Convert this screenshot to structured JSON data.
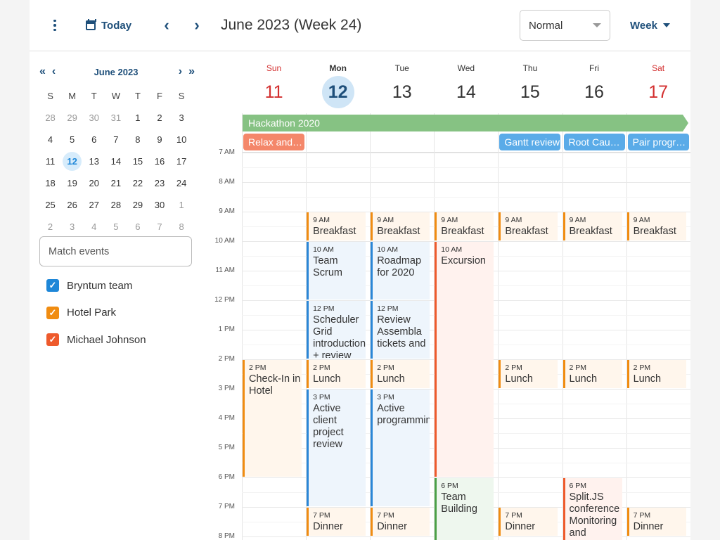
{
  "toolbar": {
    "today_label": "Today",
    "title": "June 2023 (Week 24)",
    "mode_value": "Normal",
    "view_label": "Week"
  },
  "mini_calendar": {
    "title": "June 2023",
    "weekdays": [
      "S",
      "M",
      "T",
      "W",
      "T",
      "F",
      "S"
    ],
    "weeks": [
      [
        "28",
        "29",
        "30",
        "31",
        "1",
        "2",
        "3"
      ],
      [
        "4",
        "5",
        "6",
        "7",
        "8",
        "9",
        "10"
      ],
      [
        "11",
        "12",
        "13",
        "14",
        "15",
        "16",
        "17"
      ],
      [
        "18",
        "19",
        "20",
        "21",
        "22",
        "23",
        "24"
      ],
      [
        "25",
        "26",
        "27",
        "28",
        "29",
        "30",
        "1"
      ],
      [
        "2",
        "3",
        "4",
        "5",
        "6",
        "7",
        "8"
      ]
    ],
    "today": "12"
  },
  "filter": {
    "placeholder": "Match events"
  },
  "resources": [
    {
      "label": "Bryntum team",
      "color": "#1e87d8",
      "checked": true
    },
    {
      "label": "Hotel Park",
      "color": "#f08c11",
      "checked": true
    },
    {
      "label": "Michael Johnson",
      "color": "#ee5a2c",
      "checked": true
    }
  ],
  "days": [
    {
      "name": "Sun",
      "num": "11"
    },
    {
      "name": "Mon",
      "num": "12"
    },
    {
      "name": "Tue",
      "num": "13"
    },
    {
      "name": "Wed",
      "num": "14"
    },
    {
      "name": "Thu",
      "num": "15"
    },
    {
      "name": "Fri",
      "num": "16"
    },
    {
      "name": "Sat",
      "num": "17"
    }
  ],
  "all_day": {
    "banner": "Hackathon 2020",
    "chips": [
      {
        "day": 0,
        "label": "Relax and official arrival beer",
        "color": "#f4876a"
      },
      {
        "day": 4,
        "label": "Gantt review",
        "color": "#5aabe8"
      },
      {
        "day": 5,
        "label": "Root Cause Analysis",
        "color": "#5aabe8"
      },
      {
        "day": 6,
        "label": "Pair programming",
        "color": "#5aabe8"
      }
    ]
  },
  "hours": [
    "7 AM",
    "8 AM",
    "9 AM",
    "10 AM",
    "11 AM",
    "12 PM",
    "1 PM",
    "2 PM",
    "3 PM",
    "4 PM",
    "5 PM",
    "6 PM",
    "7 PM",
    "8 PM"
  ],
  "events": [
    {
      "day": 1,
      "start": 9,
      "end": 10,
      "time": "9 AM",
      "name": "Breakfast",
      "color": "orange"
    },
    {
      "day": 2,
      "start": 9,
      "end": 10,
      "time": "9 AM",
      "name": "Breakfast",
      "color": "orange"
    },
    {
      "day": 3,
      "start": 9,
      "end": 10,
      "time": "9 AM",
      "name": "Breakfast",
      "color": "orange"
    },
    {
      "day": 4,
      "start": 9,
      "end": 10,
      "time": "9 AM",
      "name": "Breakfast",
      "color": "orange"
    },
    {
      "day": 5,
      "start": 9,
      "end": 10,
      "time": "9 AM",
      "name": "Breakfast",
      "color": "orange"
    },
    {
      "day": 6,
      "start": 9,
      "end": 10,
      "time": "9 AM",
      "name": "Breakfast",
      "color": "orange"
    },
    {
      "day": 1,
      "start": 10,
      "end": 12,
      "time": "10 AM",
      "name": "Team Scrum",
      "color": "blue"
    },
    {
      "day": 2,
      "start": 10,
      "end": 12,
      "time": "10 AM",
      "name": "Roadmap for 2020",
      "color": "blue"
    },
    {
      "day": 3,
      "start": 10,
      "end": 18,
      "time": "10 AM",
      "name": "Excursion",
      "color": "red"
    },
    {
      "day": 1,
      "start": 12,
      "end": 14,
      "time": "12 PM",
      "name": "Scheduler Grid introduction + review",
      "color": "blue"
    },
    {
      "day": 2,
      "start": 12,
      "end": 14,
      "time": "12 PM",
      "name": "Review Assembla tickets and",
      "color": "blue"
    },
    {
      "day": 0,
      "start": 14,
      "end": 18,
      "time": "2 PM",
      "name": "Check-In in Hotel",
      "color": "orange"
    },
    {
      "day": 1,
      "start": 14,
      "end": 15,
      "time": "2 PM",
      "name": "Lunch",
      "color": "orange"
    },
    {
      "day": 2,
      "start": 14,
      "end": 15,
      "time": "2 PM",
      "name": "Lunch",
      "color": "orange"
    },
    {
      "day": 4,
      "start": 14,
      "end": 15,
      "time": "2 PM",
      "name": "Lunch",
      "color": "orange"
    },
    {
      "day": 5,
      "start": 14,
      "end": 15,
      "time": "2 PM",
      "name": "Lunch",
      "color": "orange"
    },
    {
      "day": 6,
      "start": 14,
      "end": 15,
      "time": "2 PM",
      "name": "Lunch",
      "color": "orange"
    },
    {
      "day": 1,
      "start": 15,
      "end": 19,
      "time": "3 PM",
      "name": "Active client project review",
      "color": "blue"
    },
    {
      "day": 2,
      "start": 15,
      "end": 19,
      "time": "3 PM",
      "name": "Active programming",
      "color": "blue"
    },
    {
      "day": 3,
      "start": 18,
      "end": 21,
      "time": "6 PM",
      "name": "Team Building",
      "color": "green"
    },
    {
      "day": 5,
      "start": 18,
      "end": 21,
      "time": "6 PM",
      "name": "Split.JS conference Monitoring and",
      "color": "red"
    },
    {
      "day": 1,
      "start": 19,
      "end": 20,
      "time": "7 PM",
      "name": "Dinner",
      "color": "orange"
    },
    {
      "day": 2,
      "start": 19,
      "end": 20,
      "time": "7 PM",
      "name": "Dinner",
      "color": "orange"
    },
    {
      "day": 4,
      "start": 19,
      "end": 20,
      "time": "7 PM",
      "name": "Dinner",
      "color": "orange"
    },
    {
      "day": 6,
      "start": 19,
      "end": 20,
      "time": "7 PM",
      "name": "Dinner",
      "color": "orange"
    }
  ]
}
